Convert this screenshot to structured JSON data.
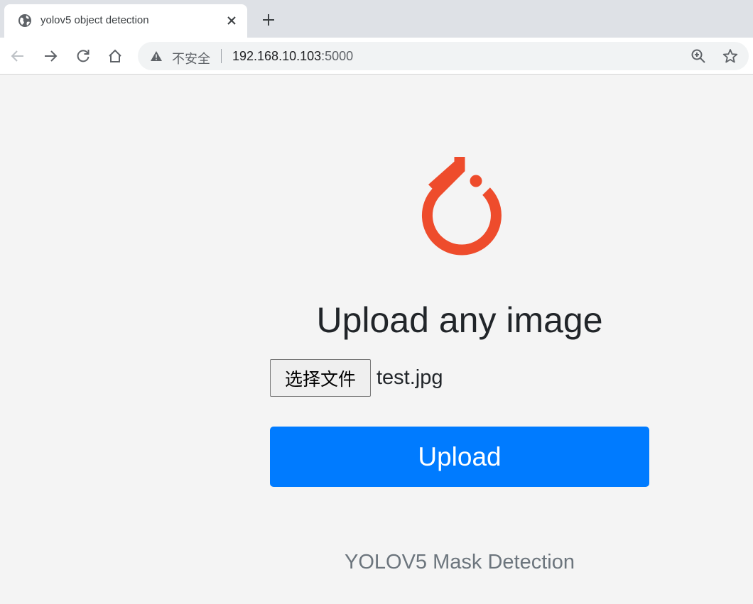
{
  "browser": {
    "tab_title": "yolov5 object detection",
    "omnibox": {
      "security_label": "不安全",
      "host": "192.168.10.103",
      "port": ":5000"
    },
    "icons": [
      "globe-icon",
      "close-icon",
      "plus-icon",
      "back-arrow-icon",
      "forward-arrow-icon",
      "reload-icon",
      "home-icon",
      "warning-icon",
      "zoom-icon",
      "star-icon"
    ]
  },
  "page": {
    "logo": "pytorch-logo",
    "heading": "Upload any image",
    "file_input": {
      "button_label": "选择文件",
      "file_name": "test.jpg"
    },
    "upload_label": "Upload",
    "footer": "YOLOV5 Mask Detection"
  },
  "colors": {
    "primary": "#007bff",
    "logo": "#ee4c2c",
    "heading": "#212529",
    "muted": "#6c757d"
  }
}
